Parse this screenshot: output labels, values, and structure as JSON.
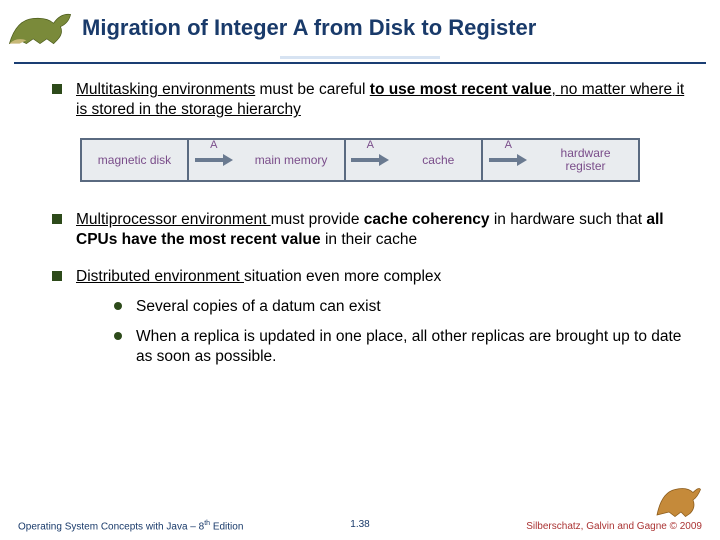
{
  "title": "Migration of Integer A from Disk to Register",
  "bullets": {
    "b1": {
      "lead_u": "Multitasking",
      "mid1": " environments",
      "mid2": " must be careful ",
      "bold1": "to use most recent value",
      "tail": ", no matter where it is stored in the storage hierarchy"
    },
    "b2": {
      "lead_u": "Multiprocessor environment ",
      "mid1": "must provide ",
      "bold1": "cache coherency",
      "mid2": " in hardware such that ",
      "bold2": "all CPUs have the most recent value",
      "tail": " in their cache"
    },
    "b3": {
      "lead_u": "Distributed environment ",
      "tail": "situation even more complex",
      "sub1": "Several copies of a datum can exist",
      "sub2": "When a replica is updated in one place, all other replicas are brought up to date as soon as possible."
    }
  },
  "diagram": {
    "box1": "magnetic disk",
    "box2": "main memory",
    "box3": "cache",
    "box4": "hardware register",
    "arrow_label": "A"
  },
  "footer": {
    "left_a": "Operating System Concepts with Java – 8",
    "left_sup": "th",
    "left_b": " Edition",
    "center": "1.38",
    "right": "Silberschatz, Galvin and Gagne © 2009"
  }
}
